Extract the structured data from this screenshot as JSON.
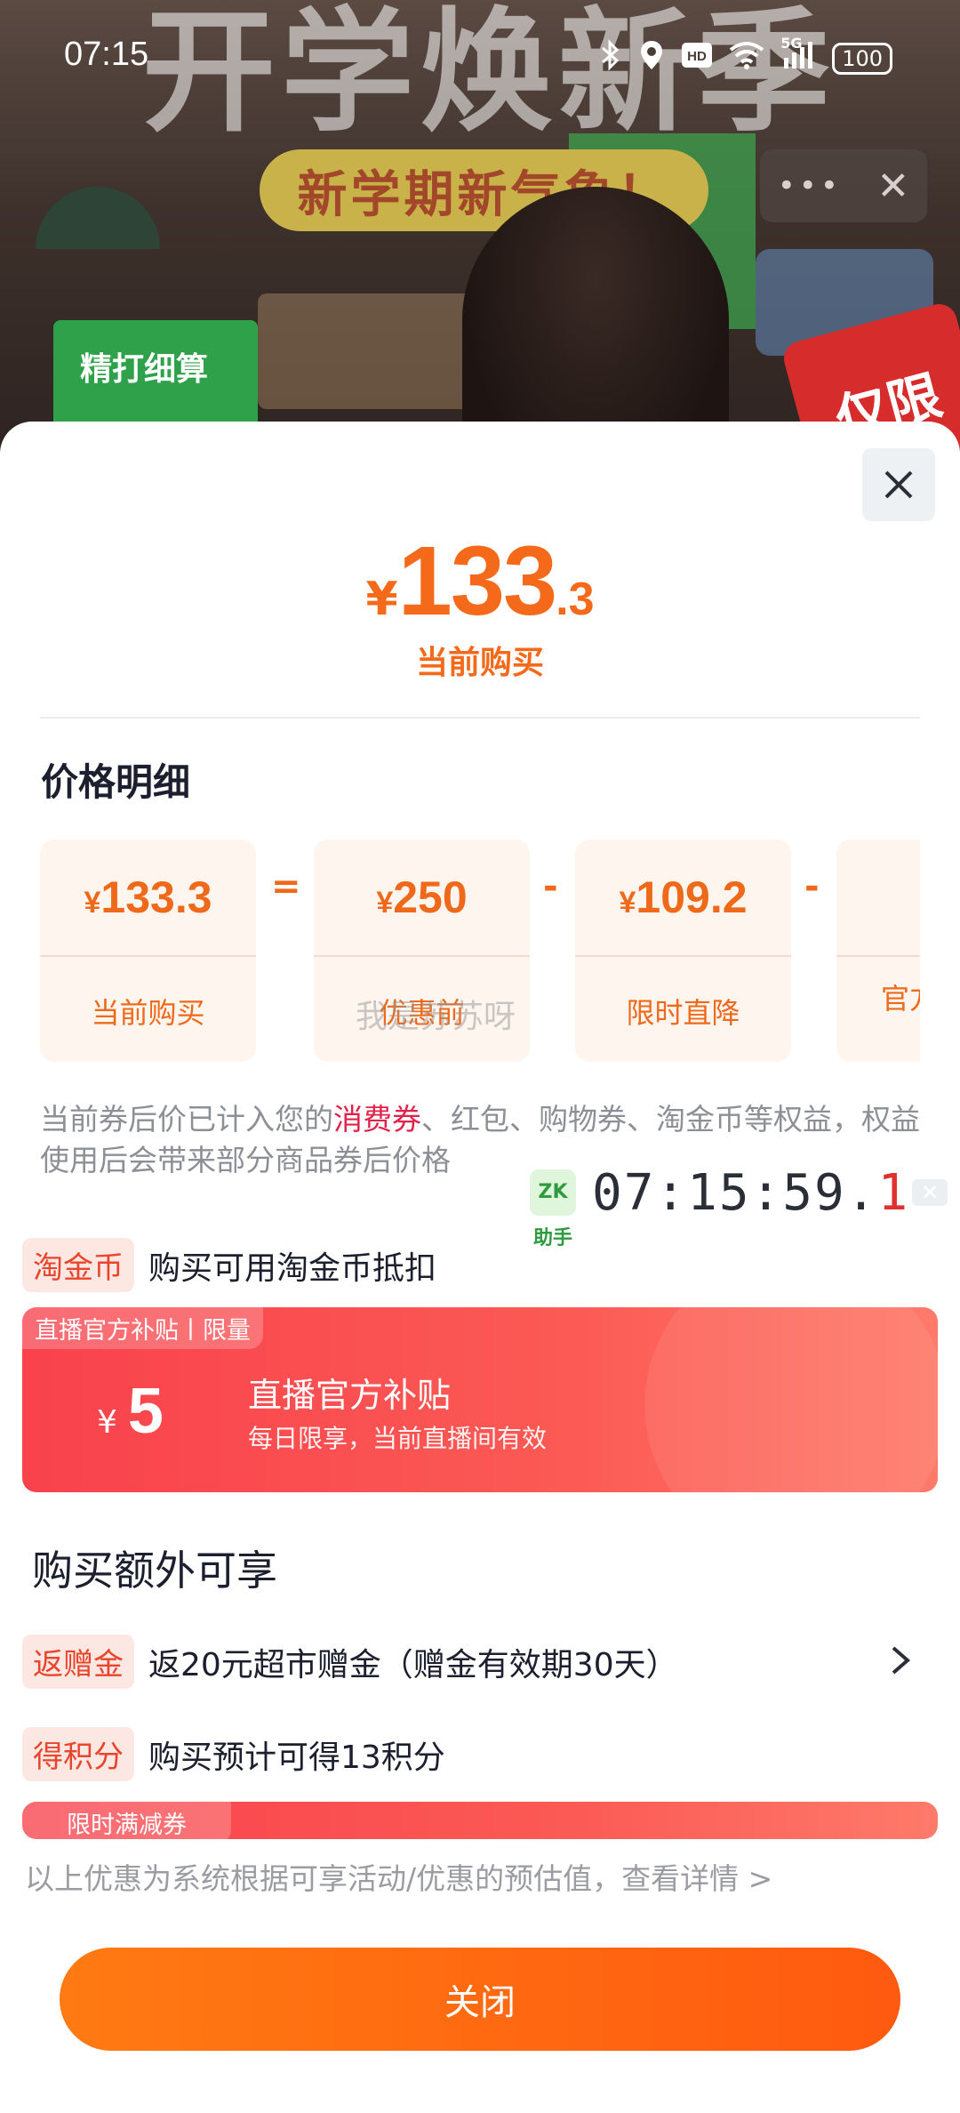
{
  "background": {
    "big_text": "开学焕新季",
    "banner": "新学期新气象！",
    "green_sign": "精打细算",
    "red_badge": "仅限"
  },
  "status_bar": {
    "time": "07:15",
    "battery": "100",
    "network": "5G",
    "hd": "HD"
  },
  "price": {
    "currency": "¥",
    "integer": "133",
    "decimal": ".3",
    "label": "当前购买"
  },
  "details": {
    "title": "价格明细",
    "cards": [
      {
        "value": "133.3",
        "currency": "¥",
        "label": "当前购买"
      },
      {
        "value": "250",
        "currency": "¥",
        "label": "优惠前"
      },
      {
        "value": "109.2",
        "currency": "¥",
        "label": "限时直降"
      },
      {
        "value": "",
        "currency": "",
        "label": "官方"
      }
    ],
    "ops": [
      "=",
      "-",
      "-"
    ],
    "watermark": "我是苏苏呀"
  },
  "note": {
    "prefix": "当前券后价已计入您的",
    "highlight": "消费券",
    "suffix": "、红包、购物券、淘金币等权益，权益使用后会带来部分商品券后价格"
  },
  "timer": {
    "logo": "ZK助手",
    "time_main": "07:15:59.",
    "time_red": "1",
    "close": "✕"
  },
  "taojinbi": {
    "tag": "淘金币",
    "text": "购买可用淘金币抵扣"
  },
  "live_coupon": {
    "tag": "直播官方补贴丨限量",
    "currency": "¥",
    "amount": "5",
    "title": "直播官方补贴",
    "subtitle": "每日限享，当前直播间有效"
  },
  "extra": {
    "title": "购买额外可享",
    "items": [
      {
        "tag": "返赠金",
        "text": "返20元超市赠金（赠金有效期30天）"
      },
      {
        "tag": "得积分",
        "text": "购买预计可得13积分"
      }
    ],
    "limited_coupon_tag": "限时满减券"
  },
  "footer_note": "以上优惠为系统根据可享活动/优惠的预估值，查看详情 >",
  "close_button": "关闭",
  "colors": {
    "accent": "#f46a1a",
    "coupon_red": "#f9424c",
    "close_grad_start": "#ff7a12",
    "close_grad_end": "#ff5a10"
  }
}
